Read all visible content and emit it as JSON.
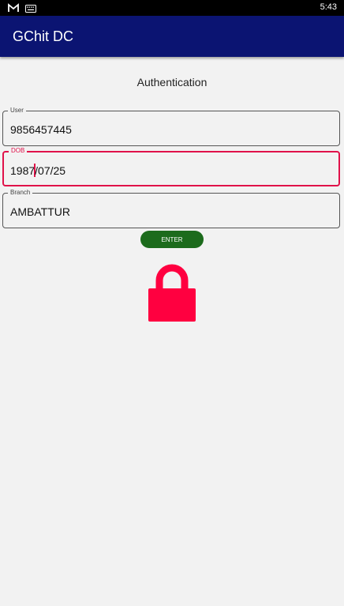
{
  "status_bar": {
    "time": "5:43",
    "icons": [
      "gmail-icon",
      "keyboard-icon"
    ]
  },
  "app_bar": {
    "title": "GChit DC",
    "color": "#0b1472"
  },
  "main": {
    "heading": "Authentication",
    "fields": {
      "user": {
        "label": "User",
        "value": "9856457445"
      },
      "dob": {
        "label": "DOB",
        "value_before_caret": "1987",
        "value_after_caret": "/07/25",
        "focused": true
      },
      "branch": {
        "label": "Branch",
        "value": "AMBATTUR"
      }
    },
    "enter_button": {
      "label": "ENTER",
      "color": "#1c6b1c"
    },
    "lock_icon": {
      "name": "lock-icon",
      "color": "#ff0040"
    }
  },
  "colors": {
    "background": "#f2f2f2",
    "focus_accent": "#e0124a"
  }
}
